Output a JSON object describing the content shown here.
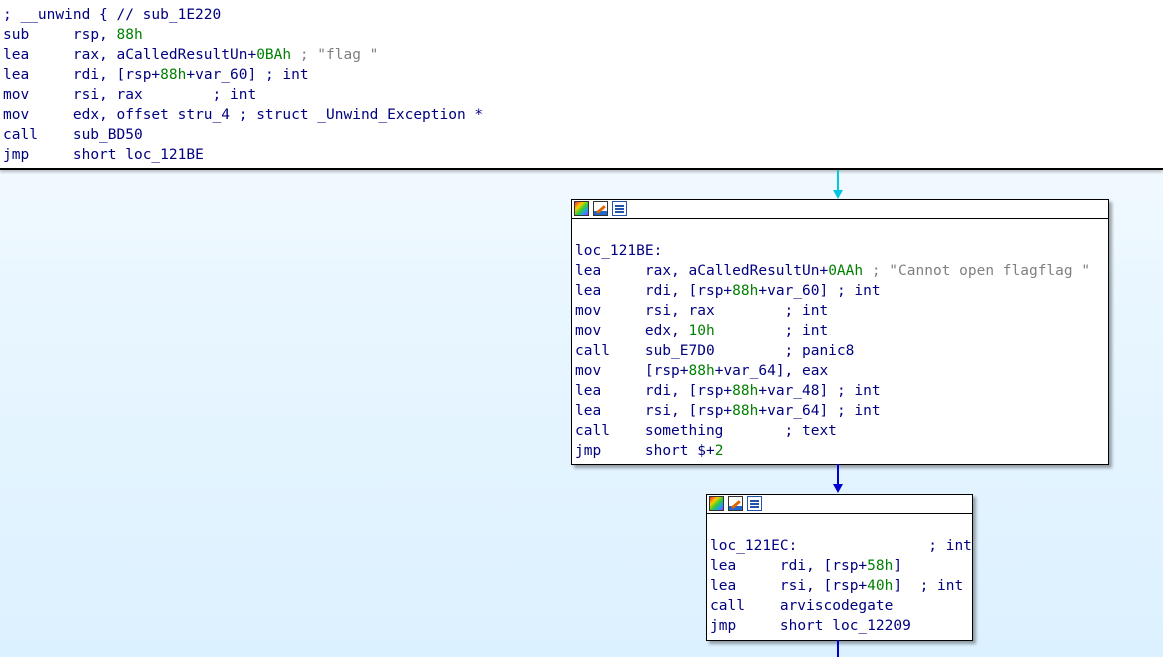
{
  "top_block": {
    "lines": [
      {
        "a": "; __unwind { // sub_1E220"
      },
      {
        "mn": "sub",
        "op": "rsp, ",
        "num": "88h"
      },
      {
        "mn": "lea",
        "op": "rax, aCalledResultUn+",
        "num": "0BAh",
        "str": " ; \"flag \""
      },
      {
        "mn": "lea",
        "op": "rdi, [rsp+",
        "num": "88h",
        "op2": "+var_60]",
        "cmt": " ; int"
      },
      {
        "mn": "mov",
        "op": "rsi, rax",
        "cmt": "        ; int"
      },
      {
        "mn": "mov",
        "op": "edx, offset stru_4",
        "cmt": " ; struct _Unwind_Exception *"
      },
      {
        "mn": "call",
        "op": "sub_BD50"
      },
      {
        "mn": "jmp",
        "op": "short loc_121BE"
      }
    ]
  },
  "node1": {
    "lines": [
      {
        "a": ""
      },
      {
        "a": "loc_121BE:"
      },
      {
        "mn": "lea",
        "op": "rax, aCalledResultUn+",
        "num": "0AAh",
        "str": " ; \"Cannot open flagflag \""
      },
      {
        "mn": "lea",
        "op": "rdi, [rsp+",
        "num": "88h",
        "op2": "+var_60]",
        "cmt": " ; int"
      },
      {
        "mn": "mov",
        "op": "rsi, rax",
        "cmt": "        ; int"
      },
      {
        "mn": "mov",
        "op": "edx, ",
        "num": "10h",
        "cmt": "        ; int"
      },
      {
        "mn": "call",
        "op": "sub_E7D0",
        "cmt": "        ; panic8"
      },
      {
        "mn": "mov",
        "op": "[rsp+",
        "num": "88h",
        "op2": "+var_64], eax"
      },
      {
        "mn": "lea",
        "op": "rdi, [rsp+",
        "num": "88h",
        "op2": "+var_48]",
        "cmt": " ; int"
      },
      {
        "mn": "lea",
        "op": "rsi, [rsp+",
        "num": "88h",
        "op2": "+var_64]",
        "cmt": " ; int"
      },
      {
        "mn": "call",
        "op": "something",
        "cmt": "       ; text"
      },
      {
        "mn": "jmp",
        "op": "short $+",
        "num": "2"
      }
    ]
  },
  "node2": {
    "lines": [
      {
        "a": ""
      },
      {
        "a": "loc_121EC:",
        "cmt": "               ; int"
      },
      {
        "mn": "lea",
        "op": "rdi, [rsp+",
        "num": "58h",
        "op2": "]"
      },
      {
        "mn": "lea",
        "op": "rsi, [rsp+",
        "num": "40h",
        "op2": "]",
        "cmt": "  ; int"
      },
      {
        "mn": "call",
        "op": "arviscodegate"
      },
      {
        "mn": "jmp",
        "op": "short loc_12209"
      }
    ]
  },
  "colors": {
    "edge_cyan": "#00c8e0",
    "edge_blue": "#0000d0",
    "text_navy": "#000080",
    "number_green": "#008000",
    "string_gray": "#808080"
  },
  "icons": [
    "color-palette-icon",
    "edit-icon",
    "graph-overview-icon"
  ]
}
